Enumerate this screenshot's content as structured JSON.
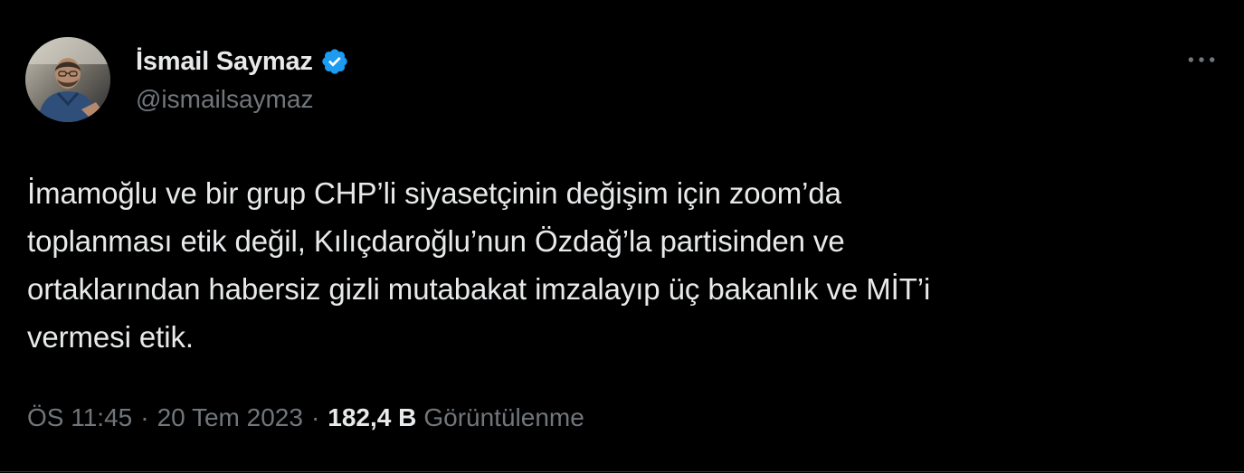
{
  "author": {
    "display_name": "İsmail Saymaz",
    "handle": "@ismailsaymaz",
    "verified": true,
    "avatar_icon": "profile-photo"
  },
  "tweet": {
    "text": "İmamoğlu ve bir grup CHP’li siyasetçinin değişim için zoom’da\ntoplanması etik değil, Kılıçdaroğlu’nun Özdağ’la partisinden ve\nortaklarından habersiz gizli mutabakat imzalayıp üç bakanlık ve MİT’i\nvermesi etik."
  },
  "meta": {
    "time": "ÖS 11:45",
    "separator": "·",
    "date": "20 Tem 2023",
    "views_count": "182,4 B",
    "views_label": "Görüntülenme"
  },
  "colors": {
    "background": "#000000",
    "primary_text": "#e7e9ea",
    "secondary_text": "#71767b",
    "verified_badge": "#1d9bf0",
    "divider": "#2f3336"
  },
  "icons": {
    "verified": "verified-badge-icon",
    "more": "more-options-icon"
  }
}
